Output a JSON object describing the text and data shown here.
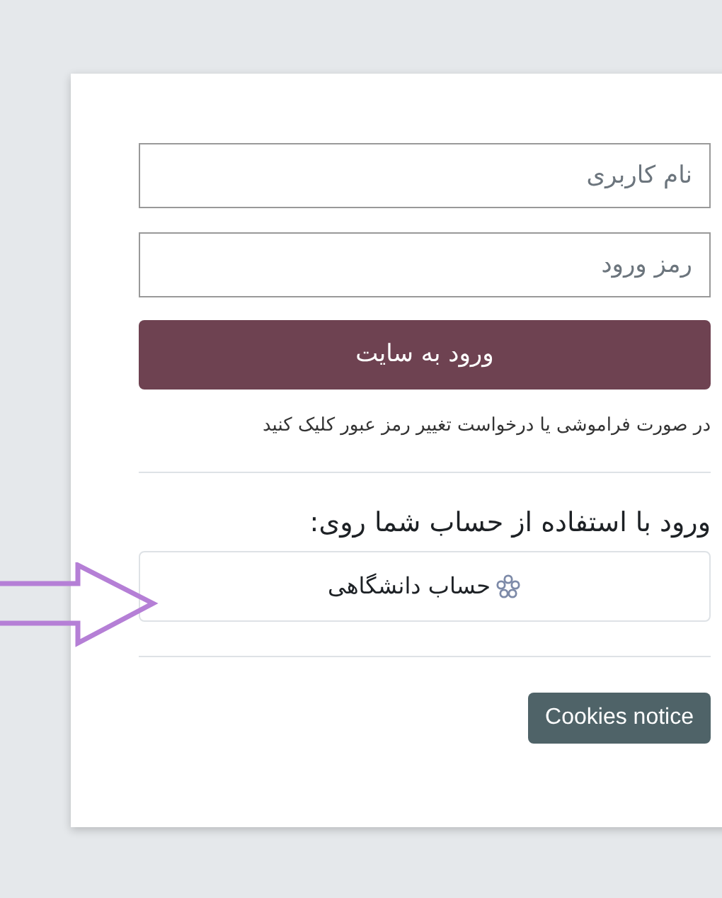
{
  "login_form": {
    "username": {
      "placeholder": "نام کاربری"
    },
    "password": {
      "placeholder": "رمز ورود"
    },
    "submit_button": "ورود به سایت",
    "forgot_password_link": "در صورت فراموشی یا درخواست تغییر رمز عبور کلیک کنید"
  },
  "identity_providers": {
    "heading": "ورود با استفاده از حساب شما روی:",
    "buttons": [
      {
        "label": "حساب دانشگاهی"
      }
    ]
  },
  "footer": {
    "cookies_button": "Cookies notice"
  }
}
